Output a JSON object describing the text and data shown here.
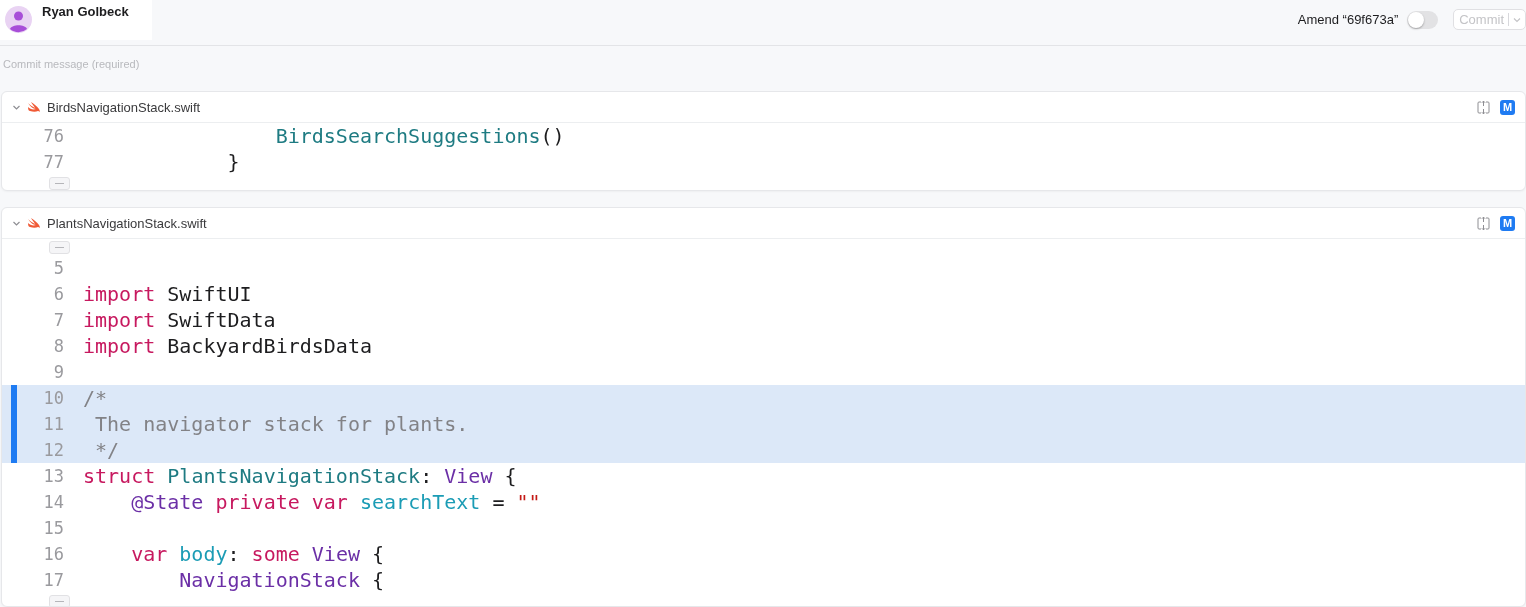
{
  "header": {
    "user_name": "Ryan Golbeck",
    "amend_label": "Amend “69f673a”",
    "amend_on": false,
    "commit_label": "Commit",
    "commit_disabled": true
  },
  "commit_message": {
    "placeholder": "Commit message (required)"
  },
  "files": [
    {
      "name": "BirdsNavigationStack.swift",
      "expanded": true,
      "badge": "M",
      "lines": [
        {
          "kind": "code",
          "number": "76",
          "staged": false,
          "tokens": [
            {
              "kind": "type",
              "text": "                BirdsSearchSuggestions"
            },
            {
              "kind": "plain",
              "text": "()"
            }
          ]
        },
        {
          "kind": "code",
          "number": "77",
          "staged": false,
          "tokens": [
            {
              "kind": "plain",
              "text": "            }"
            }
          ]
        },
        {
          "kind": "fold"
        }
      ]
    },
    {
      "name": "PlantsNavigationStack.swift",
      "expanded": true,
      "badge": "M",
      "lines": [
        {
          "kind": "fold"
        },
        {
          "kind": "code",
          "number": "5",
          "staged": false
        },
        {
          "kind": "code",
          "number": "6",
          "staged": false,
          "tokens": [
            {
              "kind": "keyword",
              "text": "import"
            },
            {
              "kind": "plain",
              "text": " SwiftUI"
            }
          ]
        },
        {
          "kind": "code",
          "number": "7",
          "staged": false,
          "tokens": [
            {
              "kind": "keyword",
              "text": "import"
            },
            {
              "kind": "plain",
              "text": " SwiftData"
            }
          ]
        },
        {
          "kind": "code",
          "number": "8",
          "staged": false,
          "tokens": [
            {
              "kind": "keyword",
              "text": "import"
            },
            {
              "kind": "plain",
              "text": " BackyardBirdsData"
            }
          ]
        },
        {
          "kind": "code",
          "number": "9",
          "staged": false
        },
        {
          "kind": "code",
          "number": "10",
          "staged": true,
          "tokens": [
            {
              "kind": "comment",
              "text": "/*"
            }
          ]
        },
        {
          "kind": "code",
          "number": "11",
          "staged": true,
          "tokens": [
            {
              "kind": "comment",
              "text": " The navigator stack for plants."
            }
          ]
        },
        {
          "kind": "code",
          "number": "12",
          "staged": true,
          "tokens": [
            {
              "kind": "comment",
              "text": " */"
            }
          ]
        },
        {
          "kind": "code",
          "number": "13",
          "staged": false,
          "tokens": [
            {
              "kind": "keyword",
              "text": "struct "
            },
            {
              "kind": "type",
              "text": "PlantsNavigationStack"
            },
            {
              "kind": "plain",
              "text": ": "
            },
            {
              "kind": "system",
              "text": "View"
            },
            {
              "kind": "plain",
              "text": " {"
            }
          ]
        },
        {
          "kind": "code",
          "number": "14",
          "staged": false,
          "tokens": [
            {
              "kind": "system",
              "text": "    @State"
            },
            {
              "kind": "keyword",
              "text": " private var "
            },
            {
              "kind": "ident",
              "text": "searchText"
            },
            {
              "kind": "plain",
              "text": " = "
            },
            {
              "kind": "string",
              "text": "\"\""
            }
          ]
        },
        {
          "kind": "code",
          "number": "15",
          "staged": false
        },
        {
          "kind": "code",
          "number": "16",
          "staged": false,
          "tokens": [
            {
              "kind": "keyword",
              "text": "    var "
            },
            {
              "kind": "ident",
              "text": "body"
            },
            {
              "kind": "plain",
              "text": ": "
            },
            {
              "kind": "keyword",
              "text": "some "
            },
            {
              "kind": "system",
              "text": "View"
            },
            {
              "kind": "plain",
              "text": " {"
            }
          ]
        },
        {
          "kind": "code",
          "number": "17",
          "staged": false,
          "tokens": [
            {
              "kind": "system",
              "text": "        NavigationStack"
            },
            {
              "kind": "plain",
              "text": " {"
            }
          ]
        },
        {
          "kind": "fold"
        }
      ]
    }
  ]
}
